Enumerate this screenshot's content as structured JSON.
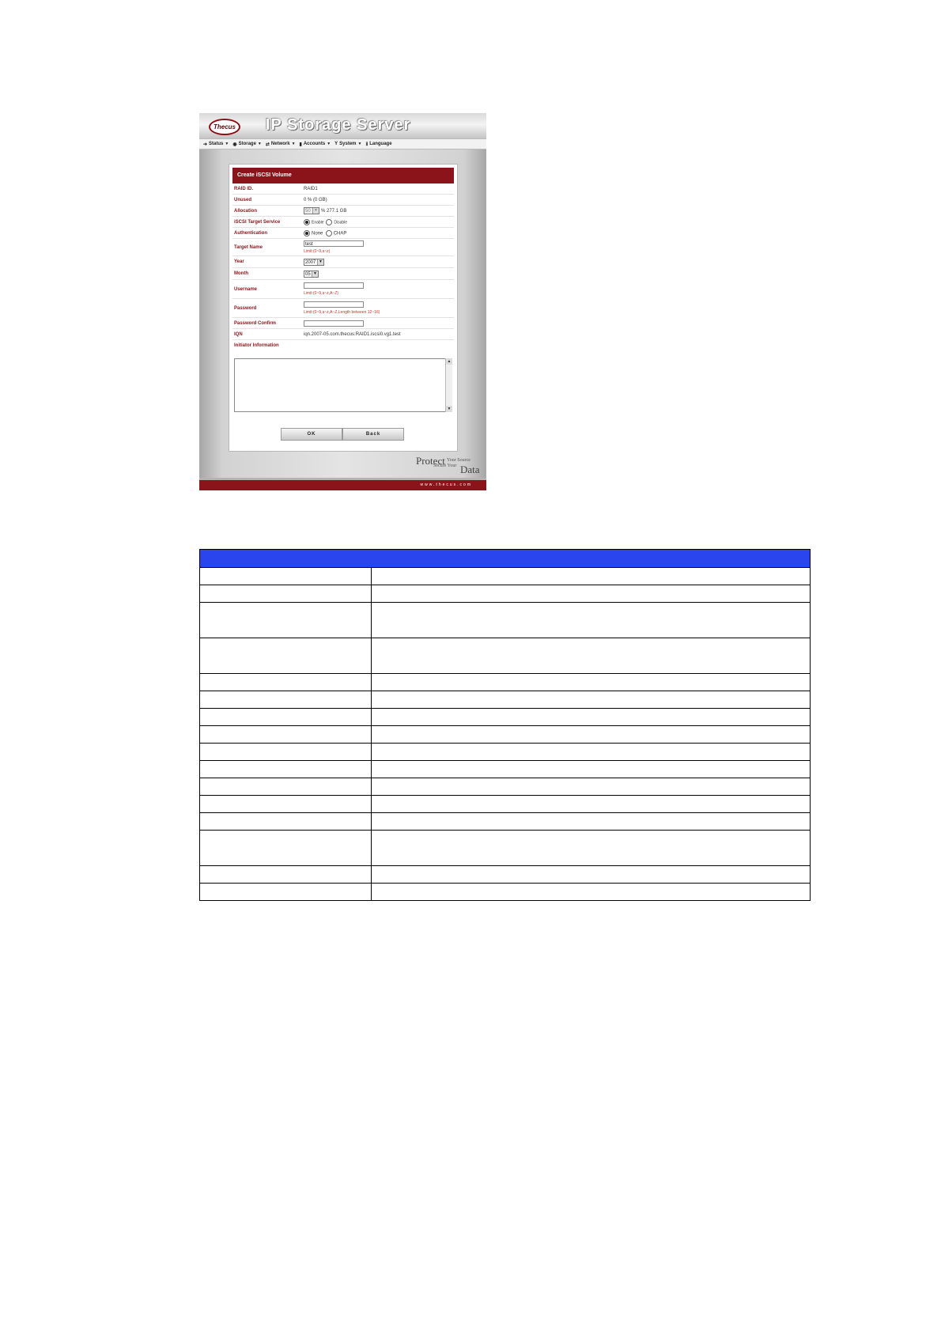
{
  "app": {
    "brand": "Thecus",
    "title": "IP Storage Server",
    "url": "www.thecus.com",
    "tagline": {
      "protect": "Protect",
      "your_source": "Your Source",
      "secure_your": "Secure Your",
      "data": "Data"
    }
  },
  "menu": [
    {
      "label": "Status",
      "icon": "status-arrow-icon"
    },
    {
      "label": "Storage",
      "icon": "storage-disc-icon"
    },
    {
      "label": "Network",
      "icon": "network-icon"
    },
    {
      "label": "Accounts",
      "icon": "accounts-icon"
    },
    {
      "label": "System",
      "icon": "system-icon"
    },
    {
      "label": "Language",
      "icon": "language-icon"
    }
  ],
  "form": {
    "title": "Create iSCSI Volume",
    "raid_id": {
      "label": "RAID ID.",
      "value": "RAID1"
    },
    "unused": {
      "label": "Unused",
      "value": "0 % (0 GB)"
    },
    "allocation": {
      "label": "Allocation",
      "selected": "50",
      "suffix": "% 277.1 GB"
    },
    "target_service": {
      "label": "iSCSI Target Service",
      "options": [
        "Enable",
        "Disable"
      ],
      "selected": "Enable"
    },
    "authentication": {
      "label": "Authentication",
      "options": [
        "None",
        "CHAP"
      ],
      "selected": "None"
    },
    "target_name": {
      "label": "Target Name",
      "value": "test",
      "hint": "Limit:(0~9,a~z)"
    },
    "year": {
      "label": "Year",
      "selected": "2007"
    },
    "month": {
      "label": "Month",
      "selected": "05"
    },
    "username": {
      "label": "Username",
      "value": "",
      "hint": "Limit:(0~9,a~z,A~Z)"
    },
    "password": {
      "label": "Password",
      "value": "",
      "hint": "Limit:(0~9,a~z,A~Z,Length between 12~16)"
    },
    "password_confirm": {
      "label": "Password Confirm",
      "value": ""
    },
    "iqn": {
      "label": "IQN",
      "value": "iqn.2007-05.com.thecus:RAID1.iscsi0.vg1.test"
    },
    "initiator": {
      "label": "Initiator Information",
      "value": ""
    },
    "ok_label": "OK",
    "back_label": "Back"
  },
  "colors": {
    "brand_red": "#8a1419",
    "table_header_blue": "#2b45ee"
  },
  "doc_table": {
    "rows": 16
  }
}
